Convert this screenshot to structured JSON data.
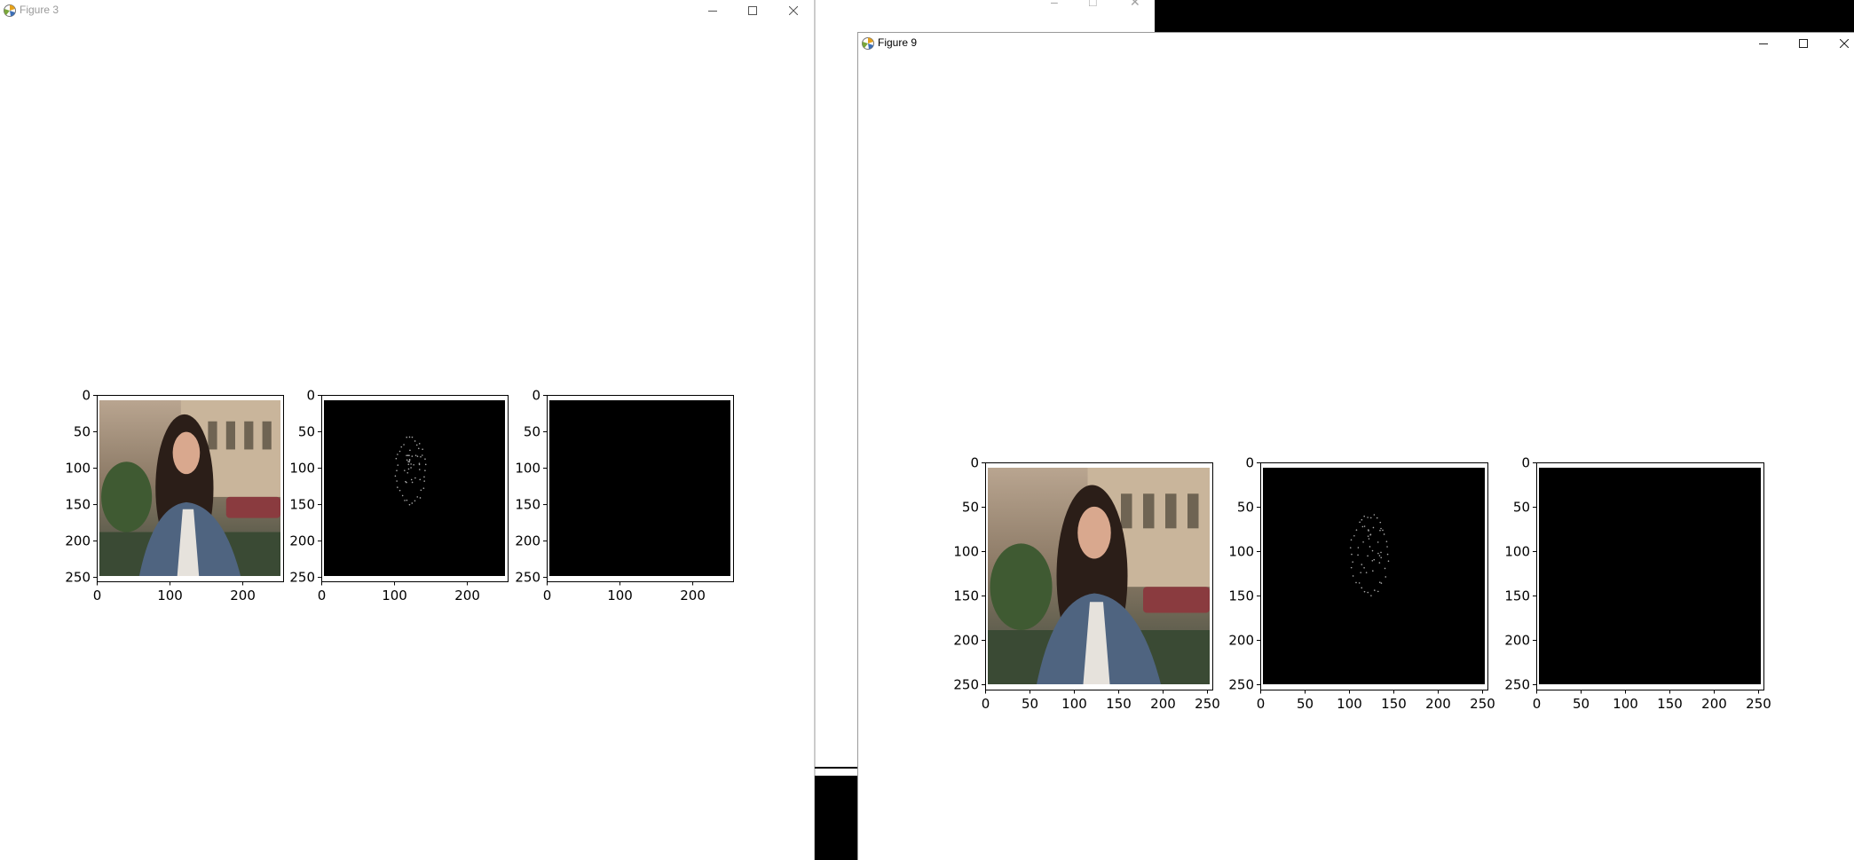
{
  "windows": {
    "figure3": {
      "title": "Figure 3",
      "x_ticks": [
        "0",
        "100",
        "200"
      ],
      "y_ticks": [
        "0",
        "50",
        "100",
        "150",
        "200",
        "250"
      ]
    },
    "figure9": {
      "title": "Figure 9",
      "x_ticks": [
        "0",
        "50",
        "100",
        "150",
        "200",
        "250"
      ],
      "y_ticks": [
        "0",
        "50",
        "100",
        "150",
        "200",
        "250"
      ]
    }
  },
  "subplots": [
    {
      "content": "photo"
    },
    {
      "content": "landmark-dots"
    },
    {
      "content": "black-mask"
    }
  ],
  "colors": {
    "image_black": "#000000",
    "dots": "#a8a8a8"
  },
  "icons": [
    "matplotlib-icon",
    "minimize-icon",
    "maximize-icon",
    "close-icon"
  ]
}
